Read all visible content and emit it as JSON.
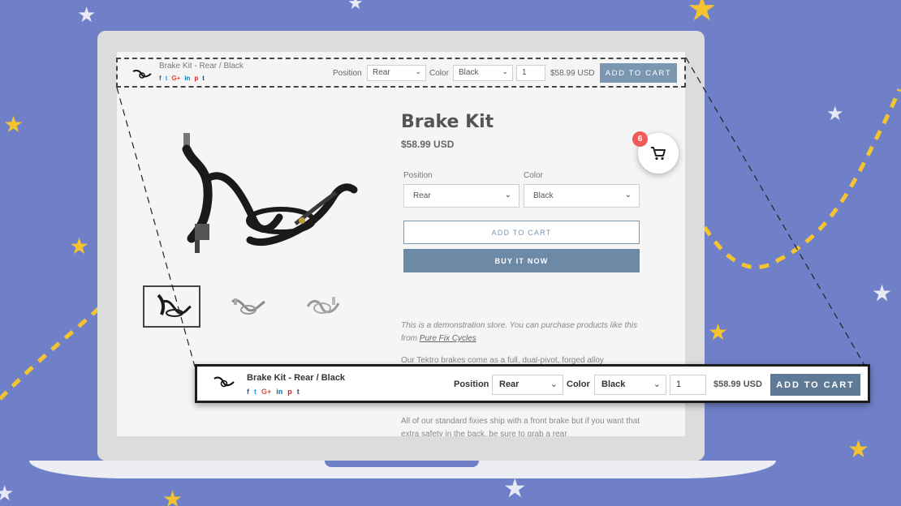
{
  "colors": {
    "background": "#6f80c8",
    "star_yellow": "#f4c430",
    "star_white": "#e7e9f5",
    "button_blue": "#7b96b1",
    "buy_now_blue": "#6c8aa6",
    "badge_red": "#ef5b5b"
  },
  "sticky_bar": {
    "product_title": "Brake Kit - Rear / Black",
    "socials": [
      "f",
      "t",
      "G+",
      "in",
      "p",
      "t"
    ],
    "position_label": "Position",
    "position_value": "Rear",
    "color_label": "Color",
    "color_value": "Black",
    "quantity": "1",
    "price": "$58.99 USD",
    "add_to_cart": "ADD TO CART"
  },
  "product": {
    "title": "Brake Kit",
    "price": "$58.99 USD",
    "position_label": "Position",
    "position_value": "Rear",
    "color_label": "Color",
    "color_value": "Black",
    "add_to_cart": "ADD TO CART",
    "buy_it_now": "BUY IT NOW",
    "demo_text": "This is a demonstration store. You can purchase products like this from",
    "demo_link": "Pure Fix Cycles",
    "desc_1": "Our Tektro brakes come as a full, dual-pivot, forged alloy",
    "desc_2": "All of our standard fixies ship with a front brake but if you want that extra safety in the back, be sure to grab a rear"
  },
  "cart": {
    "count": "6",
    "icon": "cart-icon"
  },
  "icons": {
    "chevron": "chevron-down-icon",
    "brake": "brake-caliper-icon"
  }
}
